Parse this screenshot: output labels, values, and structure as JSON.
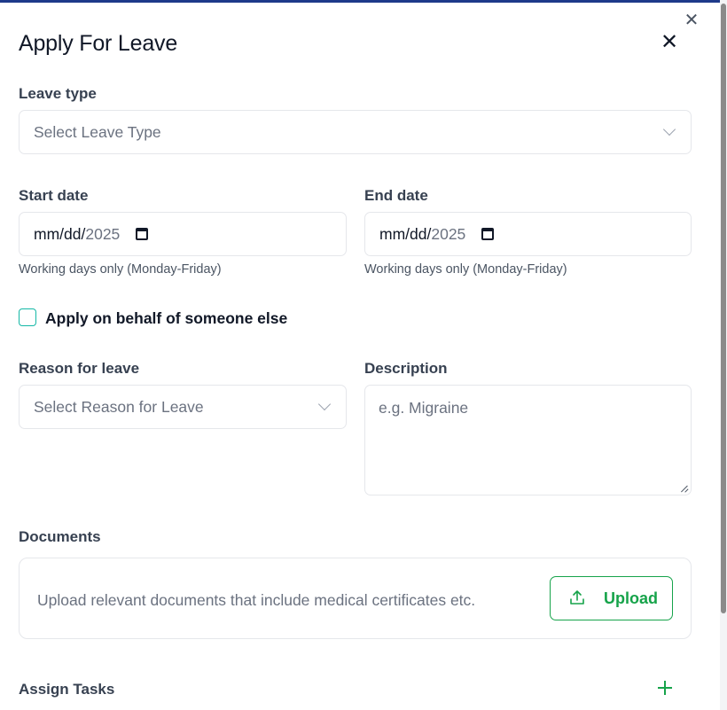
{
  "window": {
    "outer_close_icon": "✕"
  },
  "dialog": {
    "title": "Apply For Leave",
    "close_icon": "✕"
  },
  "leave_type": {
    "label": "Leave type",
    "placeholder": "Select Leave Type"
  },
  "start_date": {
    "label": "Start date",
    "value_mmdd": "mm/dd/",
    "value_year": "2025",
    "hint": "Working days only (Monday-Friday)"
  },
  "end_date": {
    "label": "End date",
    "value_mmdd": "mm/dd/",
    "value_year": "2025",
    "hint": "Working days only (Monday-Friday)"
  },
  "on_behalf": {
    "label": "Apply on behalf of someone else",
    "checked": false
  },
  "reason": {
    "label": "Reason for leave",
    "placeholder": "Select Reason for Leave"
  },
  "description": {
    "label": "Description",
    "placeholder": "e.g. Migraine"
  },
  "documents": {
    "label": "Documents",
    "helper_text": "Upload relevant documents that include medical certificates etc.",
    "upload_label": "Upload"
  },
  "tasks": {
    "label": "Assign Tasks"
  },
  "colors": {
    "accent_green": "#16a34a",
    "checkbox_teal": "#14b8a6",
    "top_bar": "#1e3a8a"
  },
  "icons": {
    "close": "close-icon",
    "chevron": "chevron-down-icon",
    "calendar": "calendar-icon",
    "upload": "upload-icon",
    "plus": "plus-icon"
  }
}
